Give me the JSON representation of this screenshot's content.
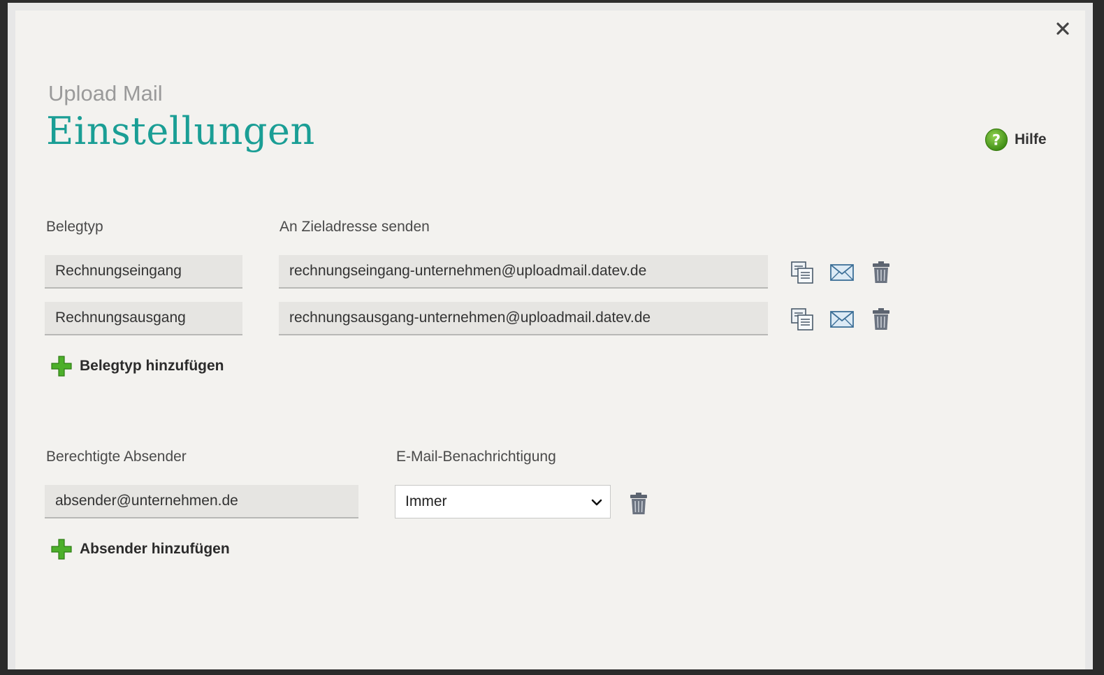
{
  "header": {
    "subtitle": "Upload Mail",
    "title": "Einstellungen",
    "help_label": "Hilfe"
  },
  "belegtypen": {
    "col_type_label": "Belegtyp",
    "col_address_label": "An Zieladresse senden",
    "rows": [
      {
        "type": "Rechnungseingang",
        "address": "rechnungseingang-unternehmen@uploadmail.datev.de"
      },
      {
        "type": "Rechnungsausgang",
        "address": "rechnungsausgang-unternehmen@uploadmail.datev.de"
      }
    ],
    "add_label": "Belegtyp hinzufügen"
  },
  "absender": {
    "col_sender_label": "Berechtigte Absender",
    "col_notify_label": "E-Mail-Benachrichtigung",
    "sender_value": "absender@unternehmen.de",
    "notify_selected": "Immer",
    "add_label": "Absender hinzufügen"
  },
  "icons": {
    "close": "close-icon",
    "help": "help-icon",
    "copy": "copy-icon",
    "mail": "envelope-icon",
    "delete": "trash-icon",
    "add": "plus-icon",
    "dropdown": "chevron-down-icon"
  },
  "colors": {
    "accent": "#1a9e95",
    "add_green": "#4caf2a",
    "help_green": "#5aa81e"
  }
}
